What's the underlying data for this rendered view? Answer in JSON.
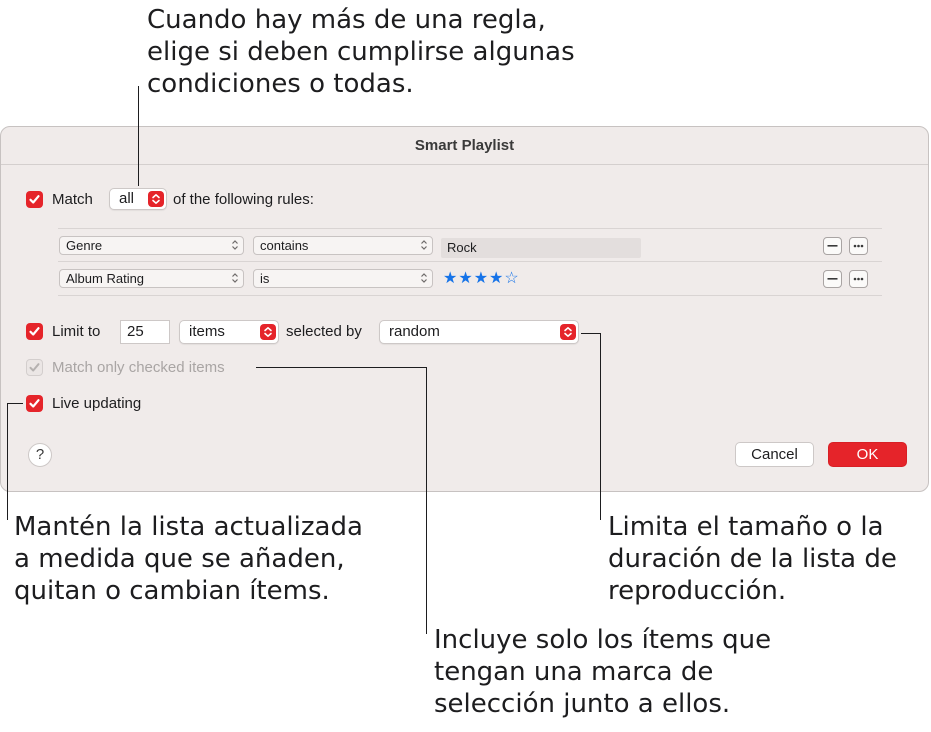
{
  "callouts": {
    "top": "Cuando hay más de una regla,\nelige si deben cumplirse algunas\ncondiciones o todas.",
    "live": "Mantén la lista actualizada\na medida que se añaden,\nquitan o cambian ítems.",
    "limit": "Limita el tamaño o la\nduración de la lista de\nreproducción.",
    "checked": "Incluye solo los ítems que\ntengan una marca de\nselección junto a ellos."
  },
  "dialog": {
    "title": "Smart Playlist",
    "match": {
      "checked": true,
      "label": "Match",
      "value": "all",
      "suffix": "of the following rules:"
    },
    "rules": [
      {
        "field": "Genre",
        "operator": "contains",
        "value": "Rock"
      },
      {
        "field": "Album Rating",
        "operator": "is",
        "rating": 4,
        "rating_max": 5,
        "stars_filled": "★★★★",
        "stars_empty": "☆"
      }
    ],
    "limit": {
      "checked": true,
      "label": "Limit to",
      "amount": "25",
      "unit": "items",
      "selected_by_label": "selected by",
      "selected_by": "random"
    },
    "match_checked": {
      "checked": true,
      "enabled": false,
      "label": "Match only checked items"
    },
    "live_updating": {
      "checked": true,
      "label": "Live updating"
    },
    "help_label": "?",
    "cancel_label": "Cancel",
    "ok_label": "OK"
  },
  "colors": {
    "accent": "#e5242a",
    "star": "#1673e8",
    "dialog_bg": "#f0ebea"
  }
}
